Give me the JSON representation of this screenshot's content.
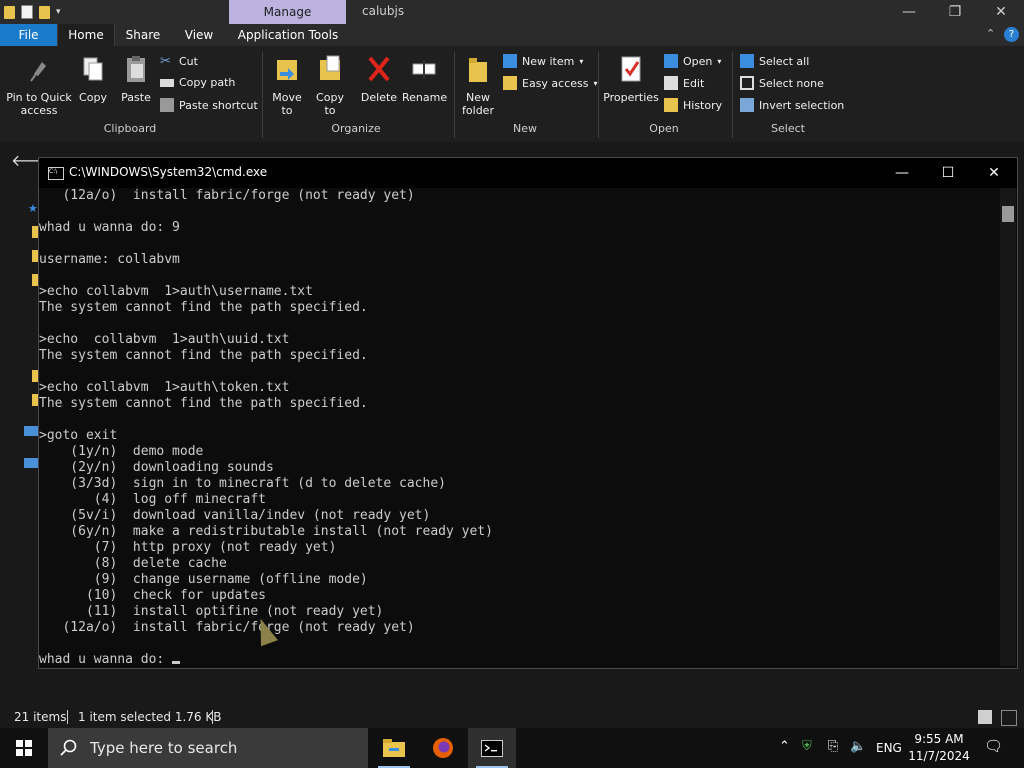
{
  "explorer": {
    "manage_tab": "Manage",
    "window_title": "calubjs",
    "tabs": [
      "File",
      "Home",
      "Share",
      "View",
      "Application Tools"
    ],
    "ribbon": {
      "clipboard": {
        "group": "Clipboard",
        "pin_to_quick_access": "Pin to Quick access",
        "copy": "Copy",
        "paste": "Paste",
        "cut": "Cut",
        "copy_path": "Copy path",
        "paste_shortcut": "Paste shortcut"
      },
      "organize": {
        "group": "Organize",
        "move_to": "Move to",
        "copy_to": "Copy to",
        "delete": "Delete",
        "rename": "Rename"
      },
      "new": {
        "group": "New",
        "new_folder": "New folder",
        "new_item": "New item",
        "easy_access": "Easy access"
      },
      "open": {
        "group": "Open",
        "properties": "Properties",
        "open": "Open",
        "edit": "Edit",
        "history": "History"
      },
      "select": {
        "group": "Select",
        "select_all": "Select all",
        "select_none": "Select none",
        "invert_selection": "Invert selection"
      }
    },
    "status": {
      "items": "21 items",
      "selected": "1 item selected  1.76 KB"
    }
  },
  "console": {
    "title": "C:\\WINDOWS\\System32\\cmd.exe",
    "lines": [
      "   (12a/o)  install fabric/forge (not ready yet)",
      "",
      "whad u wanna do: 9",
      "",
      "username: collabvm",
      "",
      ">echo collabvm  1>auth\\username.txt",
      "The system cannot find the path specified.",
      "",
      ">echo  collabvm  1>auth\\uuid.txt",
      "The system cannot find the path specified.",
      "",
      ">echo collabvm  1>auth\\token.txt",
      "The system cannot find the path specified.",
      "",
      ">goto exit",
      "    (1y/n)  demo mode",
      "    (2y/n)  downloading sounds",
      "    (3/3d)  sign in to minecraft (d to delete cache)",
      "       (4)  log off minecraft",
      "    (5v/i)  download vanilla/indev (not ready yet)",
      "    (6y/n)  make a redistributable install (not ready yet)",
      "       (7)  http proxy (not ready yet)",
      "       (8)  delete cache",
      "       (9)  change username (offline mode)",
      "      (10)  check for updates",
      "      (11)  install optifine (not ready yet)",
      "   (12a/o)  install fabric/forge (not ready yet)",
      ""
    ],
    "prompt": "whad u wanna do: "
  },
  "taskbar": {
    "search_placeholder": "Type here to search",
    "language": "ENG",
    "time": "9:55 AM",
    "date": "11/7/2024"
  },
  "colors": {
    "file_tab": "#1979ca",
    "manage_tab": "#bdb3e0",
    "console_bg": "#0c0c0c",
    "console_text": "#cccccc"
  }
}
